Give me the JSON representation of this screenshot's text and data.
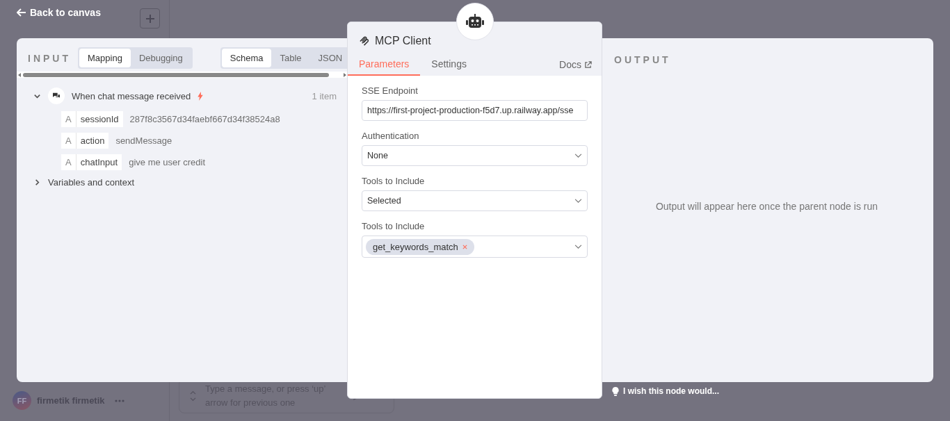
{
  "back_link": {
    "label": "Back to canvas"
  },
  "background": {
    "user": {
      "initials": "FF",
      "name": "firmetik firmetik"
    },
    "chat_input": {
      "placeholder": "Type a message, or press ‘up’ arrow for previous one"
    }
  },
  "input_panel": {
    "title": "INPUT",
    "mode_tabs": [
      {
        "label": "Mapping",
        "selected": true
      },
      {
        "label": "Debugging",
        "selected": false
      }
    ],
    "view_tabs": [
      {
        "label": "Schema",
        "selected": true
      },
      {
        "label": "Table",
        "selected": false
      },
      {
        "label": "JSON",
        "selected": false
      }
    ],
    "tree": [
      {
        "label": "When chat message received",
        "expanded": true,
        "trigger": true,
        "count": "1 item",
        "fields": [
          {
            "type": "A",
            "key": "sessionId",
            "value": "287f8c3567d34faebf667d34f38524a8"
          },
          {
            "type": "A",
            "key": "action",
            "value": "sendMessage"
          },
          {
            "type": "A",
            "key": "chatInput",
            "value": "give me user credit"
          }
        ]
      },
      {
        "label": "Variables and context",
        "expanded": false,
        "trigger": false
      }
    ]
  },
  "node": {
    "title": "MCP Client",
    "tabs": [
      {
        "label": "Parameters",
        "selected": true
      },
      {
        "label": "Settings",
        "selected": false
      }
    ],
    "docs": "Docs",
    "params": [
      {
        "kind": "text",
        "label": "SSE Endpoint",
        "value": "https://first-project-production-f5d7.up.railway.app/sse"
      },
      {
        "kind": "select",
        "label": "Authentication",
        "value": "None"
      },
      {
        "kind": "select",
        "label": "Tools to Include",
        "value": "Selected"
      },
      {
        "kind": "multiselect",
        "label": "Tools to Include",
        "chips": [
          "get_keywords_match"
        ]
      }
    ]
  },
  "output_panel": {
    "title": "OUTPUT",
    "message": "Output will appear here once the parent node is run"
  },
  "feedback": {
    "label": "I wish this node would..."
  }
}
